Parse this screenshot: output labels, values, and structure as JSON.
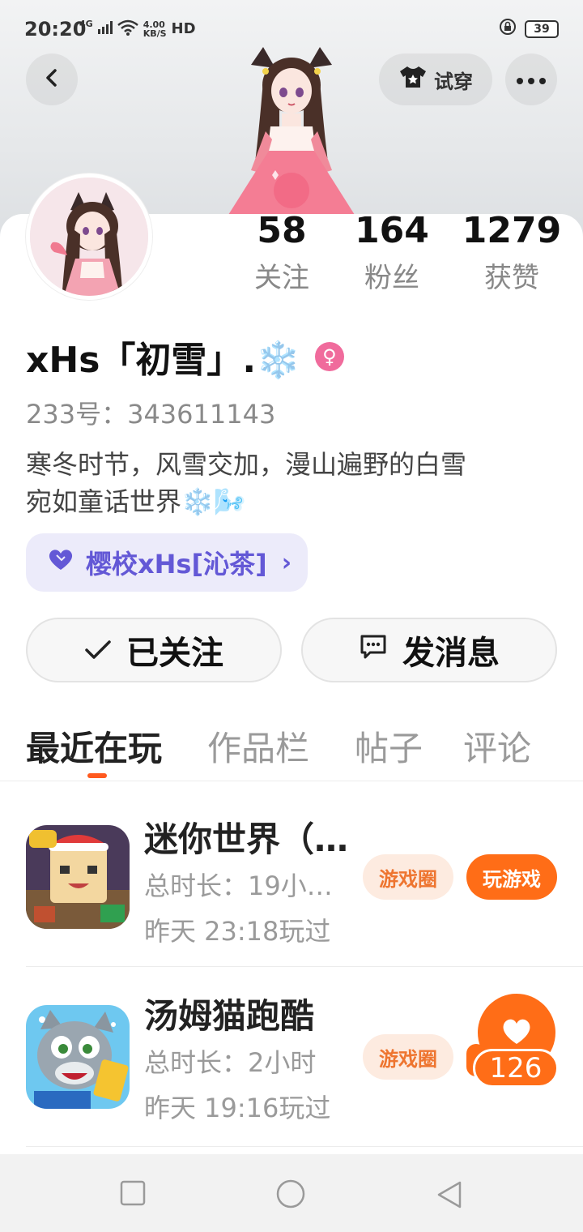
{
  "status_bar": {
    "time": "20:20",
    "network": "4G",
    "speed_value": "4.00",
    "speed_unit": "KB/S",
    "hd": "HD",
    "battery": "39"
  },
  "header": {
    "try_on_label": "试穿"
  },
  "stats": [
    {
      "value": "58",
      "label": "关注"
    },
    {
      "value": "164",
      "label": "粉丝"
    },
    {
      "value": "1279",
      "label": "获赞"
    }
  ],
  "profile": {
    "name": "xHs「初雪」.❄️",
    "gender_symbol": "♀",
    "uid": "233号：343611143",
    "bio_line1": "寒冬时节，风雪交加，漫山遍野的白雪",
    "bio_line2": "宛如童话世界❄️🌬️",
    "club": "樱校xHs[沁茶]",
    "club_arrow": "›"
  },
  "actions": {
    "follow": "已关注",
    "message": "发消息"
  },
  "tabs": [
    {
      "label": "最近在玩"
    },
    {
      "label": "作品栏"
    },
    {
      "label": "帖子"
    },
    {
      "label": "评论"
    }
  ],
  "games": [
    {
      "title": "迷你世界（…",
      "duration": "总时长：19小…",
      "last_played": "昨天 23:18玩过",
      "circle_label": "游戏圈",
      "play_label": "玩游戏"
    },
    {
      "title": "汤姆猫跑酷",
      "duration": "总时长：2小时",
      "last_played": "昨天 19:16玩过",
      "circle_label": "游戏圈",
      "likes": "126"
    }
  ],
  "colors": {
    "accent": "#ff6d17",
    "club_text": "#6358d6",
    "club_bg": "#ecebfa",
    "gender": "#f06b9c"
  }
}
